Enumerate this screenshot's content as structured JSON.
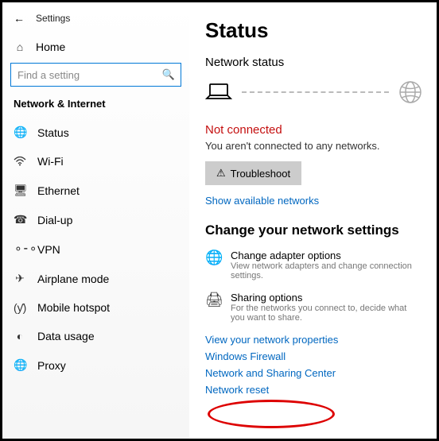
{
  "header": {
    "app_title": "Settings"
  },
  "sidebar": {
    "home_label": "Home",
    "search_placeholder": "Find a setting",
    "section_title": "Network & Internet",
    "items": [
      {
        "icon": "status",
        "label": "Status"
      },
      {
        "icon": "wifi",
        "label": "Wi-Fi"
      },
      {
        "icon": "ethernet",
        "label": "Ethernet"
      },
      {
        "icon": "dialup",
        "label": "Dial-up"
      },
      {
        "icon": "vpn",
        "label": "VPN"
      },
      {
        "icon": "airplane",
        "label": "Airplane mode"
      },
      {
        "icon": "hotspot",
        "label": "Mobile hotspot"
      },
      {
        "icon": "data",
        "label": "Data usage"
      },
      {
        "icon": "proxy",
        "label": "Proxy"
      }
    ]
  },
  "main": {
    "title": "Status",
    "network_status_heading": "Network status",
    "connection_state": "Not connected",
    "connection_sub": "You aren't connected to any networks.",
    "troubleshoot_label": "Troubleshoot",
    "show_networks_link": "Show available networks",
    "change_heading": "Change your network settings",
    "options": [
      {
        "title": "Change adapter options",
        "desc": "View network adapters and change connection settings."
      },
      {
        "title": "Sharing options",
        "desc": "For the networks you connect to, decide what you want to share."
      }
    ],
    "links": [
      "View your network properties",
      "Windows Firewall",
      "Network and Sharing Center",
      "Network reset"
    ]
  }
}
